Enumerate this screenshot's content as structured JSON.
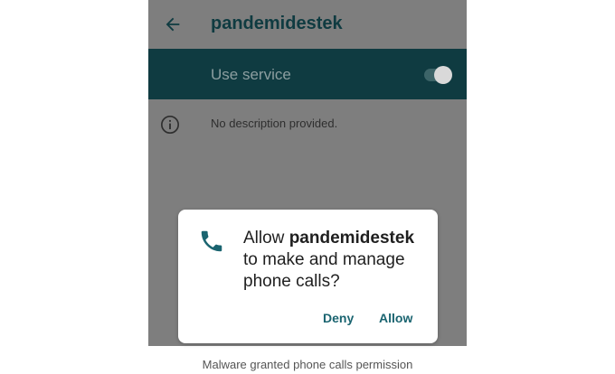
{
  "app_bar": {
    "back_icon": "arrow-left-icon",
    "title": "pandemidestek"
  },
  "service": {
    "label": "Use service",
    "toggle_on": true
  },
  "description": {
    "icon": "info-icon",
    "text": "No description provided."
  },
  "dialog": {
    "icon": "phone-icon",
    "prefix": "Allow ",
    "app_name": "pandemidestek",
    "suffix": " to make and manage phone calls?",
    "deny_label": "Deny",
    "allow_label": "Allow"
  },
  "caption": "Malware granted phone calls permission",
  "colors": {
    "accent": "#0f3b41",
    "scrim": "#7e7e7e",
    "button_text": "#1a6470"
  }
}
